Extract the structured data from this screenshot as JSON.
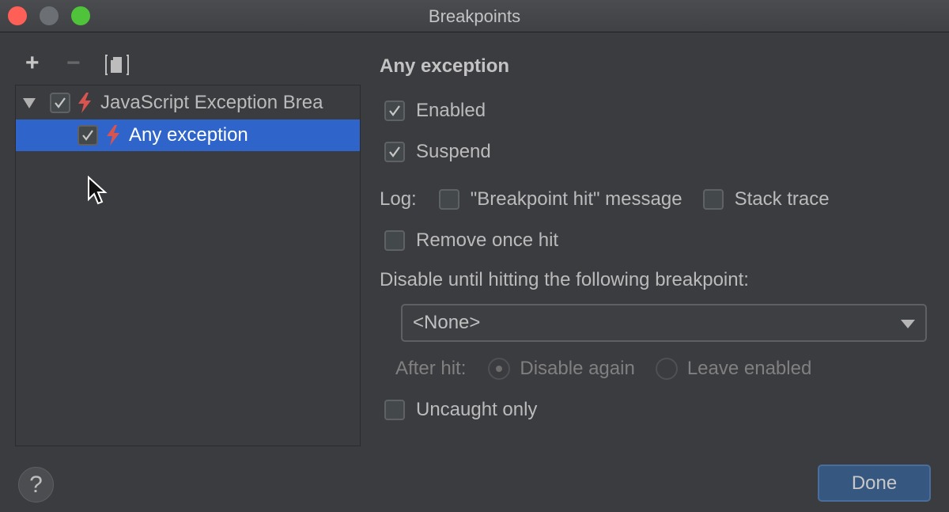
{
  "window": {
    "title": "Breakpoints",
    "controls": [
      "close",
      "minimize",
      "maximize"
    ]
  },
  "toolbar": {
    "add_icon": "+",
    "remove_icon": "−",
    "group_icon": "group-by-file-icon"
  },
  "tree": {
    "items": [
      {
        "label": "JavaScript Exception Brea",
        "checked": true,
        "expanded": true,
        "icon": "lightning-bolt-icon",
        "selected": false
      },
      {
        "label": "Any exception",
        "checked": true,
        "icon": "lightning-bolt-icon",
        "selected": true
      }
    ]
  },
  "details": {
    "heading": "Any exception",
    "enabled_label": "Enabled",
    "enabled": true,
    "suspend_label": "Suspend",
    "suspend": true,
    "log_label": "Log:",
    "log_message_label": "\"Breakpoint hit\" message",
    "log_message": false,
    "stack_trace_label": "Stack trace",
    "stack_trace": false,
    "remove_once_hit_label": "Remove once hit",
    "remove_once_hit": false,
    "disable_until_label": "Disable until hitting the following breakpoint:",
    "disable_until_value": "<None>",
    "after_hit_label": "After hit:",
    "after_hit_options": [
      "Disable again",
      "Leave enabled"
    ],
    "after_hit_selected": "Disable again",
    "uncaught_only_label": "Uncaught only",
    "uncaught_only": false
  },
  "footer": {
    "help_label": "?",
    "done_label": "Done"
  },
  "colors": {
    "selection": "#2f65ca",
    "bolt": "#d9534f",
    "done_button": "#365880"
  }
}
